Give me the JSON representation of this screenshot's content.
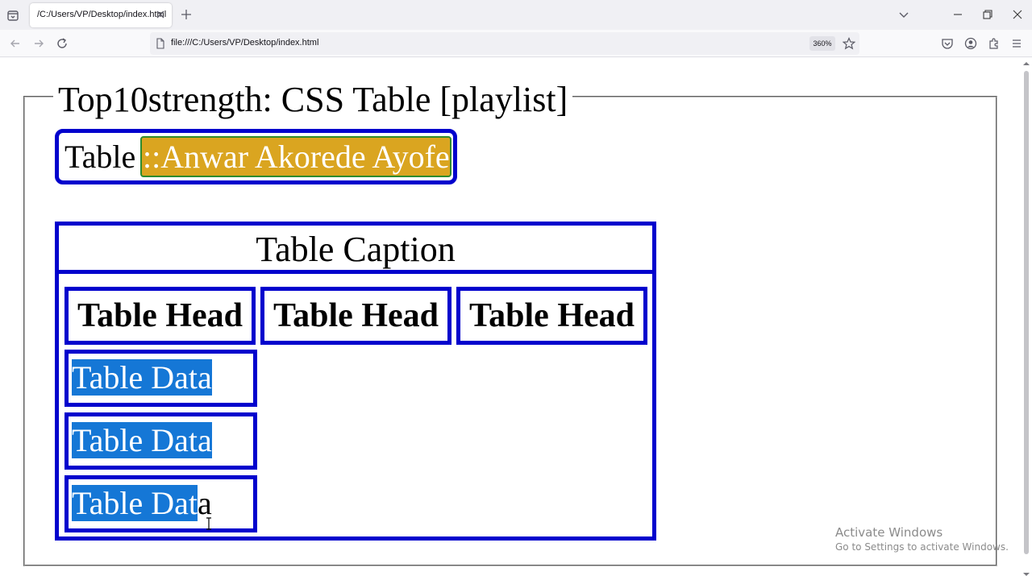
{
  "browser": {
    "tab_title": "/C:/Users/VP/Desktop/index.html",
    "url": "file:///C:/Users/VP/Desktop/index.html",
    "zoom": "360%"
  },
  "page": {
    "legend": "Top10strength: CSS Table [playlist]",
    "name_label": "Table",
    "name_value": "::Anwar Akorede Ayofe",
    "caption": "Table Caption",
    "headers": [
      "Table Head",
      "Table Head",
      "Table Head"
    ],
    "rows": [
      {
        "selected": "Table Data",
        "rest": ""
      },
      {
        "selected": "Table Data",
        "rest": ""
      },
      {
        "selected": "Table Dat",
        "rest": "a"
      }
    ]
  },
  "watermark": {
    "title": "Activate Windows",
    "subtitle": "Go to Settings to activate Windows."
  },
  "colors": {
    "border": "#0000cd",
    "name_bg": "#daa520",
    "selection": "#1577d6"
  }
}
